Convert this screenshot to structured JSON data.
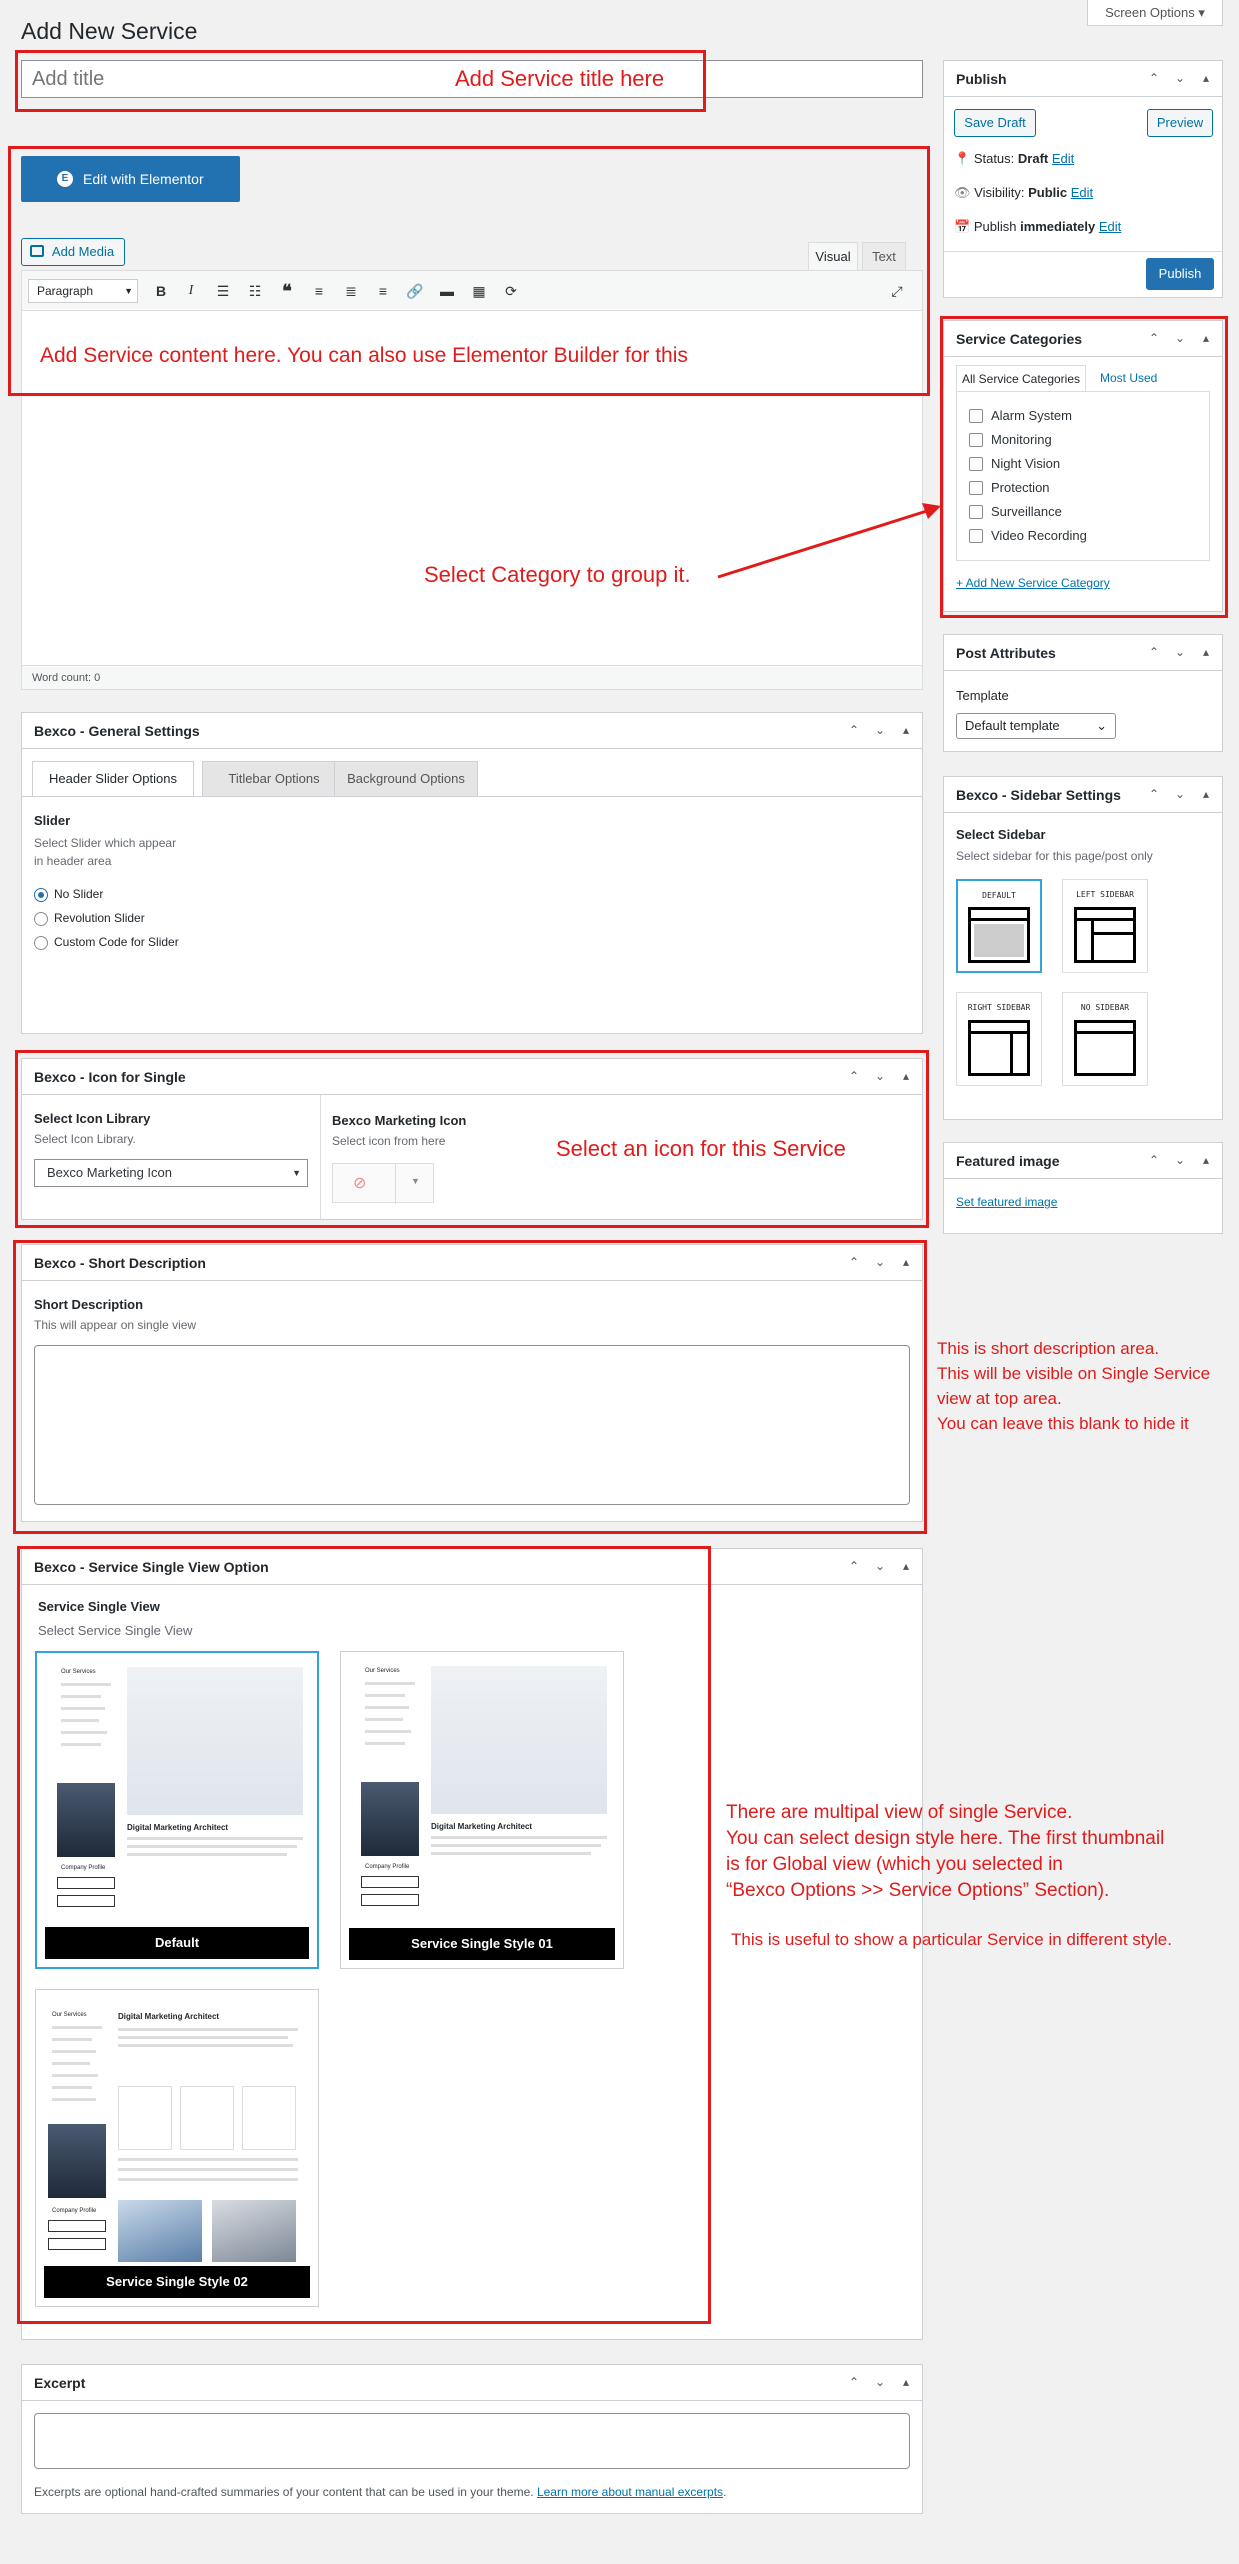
{
  "page": {
    "title": "Add New Service",
    "screen_options": "Screen Options ▾"
  },
  "title_field": {
    "placeholder": "Add title"
  },
  "editor": {
    "elementor_button": "Edit with Elementor",
    "add_media": "Add Media",
    "tab_visual": "Visual",
    "tab_text": "Text",
    "format_select": "Paragraph",
    "word_count": "Word count: 0"
  },
  "publish": {
    "title": "Publish",
    "save_draft": "Save Draft",
    "preview": "Preview",
    "status_label": "Status:",
    "status_value": "Draft",
    "visibility_label": "Visibility:",
    "visibility_value": "Public",
    "publish_label": "Publish",
    "publish_value": "immediately",
    "edit": "Edit",
    "publish_button": "Publish"
  },
  "categories": {
    "title": "Service Categories",
    "tab_all": "All Service Categories",
    "tab_most": "Most Used",
    "items": [
      "Alarm System",
      "Monitoring",
      "Night Vision",
      "Protection",
      "Surveillance",
      "Video Recording"
    ],
    "add_new": "+ Add New Service Category"
  },
  "post_attributes": {
    "title": "Post Attributes",
    "template_label": "Template",
    "template_value": "Default template"
  },
  "sidebar_settings": {
    "title": "Bexco - Sidebar Settings",
    "select_label": "Select Sidebar",
    "select_desc": "Select sidebar for this page/post only",
    "options": [
      "DEFAULT",
      "LEFT SIDEBAR",
      "RIGHT SIDEBAR",
      "NO SIDEBAR"
    ]
  },
  "featured_image": {
    "title": "Featured image",
    "link": "Set featured image"
  },
  "general_settings": {
    "title": "Bexco - General Settings",
    "tabs": [
      "Header Slider Options",
      "Titlebar Options",
      "Background Options"
    ],
    "slider_label": "Slider",
    "slider_desc_1": "Select Slider which appear",
    "slider_desc_2": "in header area",
    "radios": [
      "No Slider",
      "Revolution Slider",
      "Custom Code for Slider"
    ]
  },
  "icon_single": {
    "title": "Bexco - Icon for Single",
    "lib_label": "Select Icon Library",
    "lib_desc": "Select Icon Library.",
    "lib_value": "Bexco Marketing Icon",
    "icon_label": "Bexco Marketing Icon",
    "icon_desc": "Select icon from here"
  },
  "short_desc": {
    "title": "Bexco - Short Description",
    "label": "Short Description",
    "desc": "This will appear on single view"
  },
  "single_view": {
    "title": "Bexco - Service Single View Option",
    "label": "Service Single View",
    "desc": "Select Service Single View",
    "thumbs": [
      "Default",
      "Service Single Style 01",
      "Service Single Style 02"
    ],
    "mock_heading": "Digital Marketing Architect",
    "mock_sidebar_title": "Our Services",
    "mock_profile": "Company Profile"
  },
  "excerpt": {
    "title": "Excerpt",
    "help": "Excerpts are optional hand-crafted summaries of your content that can be used in your theme.",
    "help_link": "Learn more about manual excerpts"
  },
  "annotations": {
    "title_hint": "Add Service title here",
    "content_hint": "Add Service content here. You can also use Elementor Builder for this",
    "category_hint": "Select Category to group it.",
    "icon_hint": "Select an icon for this Service",
    "short_desc_hint": [
      "This is short description area.",
      "This will be visible on Single Service",
      "view at top area.",
      "You can leave this blank to hide it"
    ],
    "single_view_hint": [
      "There are multipal view of single Service.",
      "You can select design style here. The first thumbnail",
      "is for Global view (which you selected in",
      "“Bexco Options >> Service Options” Section)."
    ],
    "single_view_hint_2": "This is useful to show a particular Service in different style."
  },
  "colors": {
    "accent": "#2271b1",
    "annotation": "#e01b1b",
    "selected_border": "#33a3dc"
  }
}
